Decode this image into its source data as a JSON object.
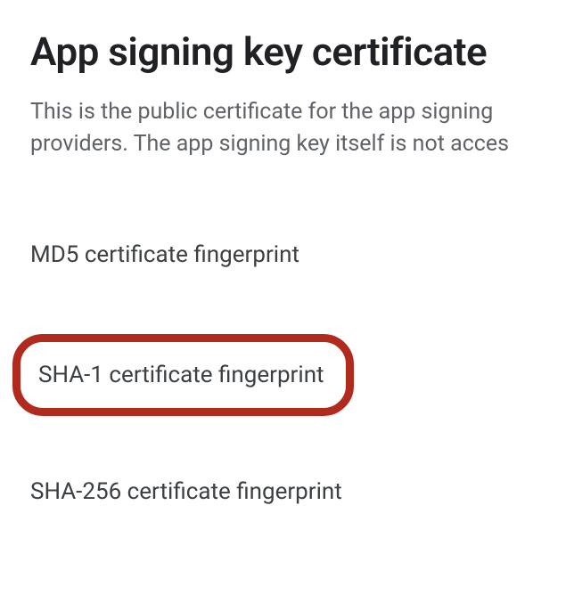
{
  "header": {
    "title": "App signing key certificate",
    "description_line1": "This is the public certificate for the app signing",
    "description_line2": "providers. The app signing key itself is not acces"
  },
  "fingerprints": {
    "md5": {
      "label": "MD5 certificate fingerprint"
    },
    "sha1": {
      "label": "SHA-1 certificate fingerprint"
    },
    "sha256": {
      "label": "SHA-256 certificate fingerprint"
    }
  },
  "colors": {
    "highlight_border": "#b02a1e"
  }
}
